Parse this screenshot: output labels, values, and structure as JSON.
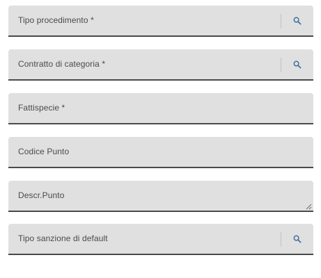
{
  "form": {
    "fields": [
      {
        "label": "Tipo procedimento *",
        "has_search": true
      },
      {
        "label": "Contratto di categoria *",
        "has_search": true
      },
      {
        "label": "Fattispecie *",
        "has_search": false
      },
      {
        "label": "Codice Punto",
        "has_search": false
      },
      {
        "label": "Descr.Punto",
        "has_search": false,
        "multiline": true
      },
      {
        "label": "Tipo sanzione di default",
        "has_search": true
      }
    ],
    "search_icon": "search-icon",
    "accent_color": "#3f6f9e"
  }
}
